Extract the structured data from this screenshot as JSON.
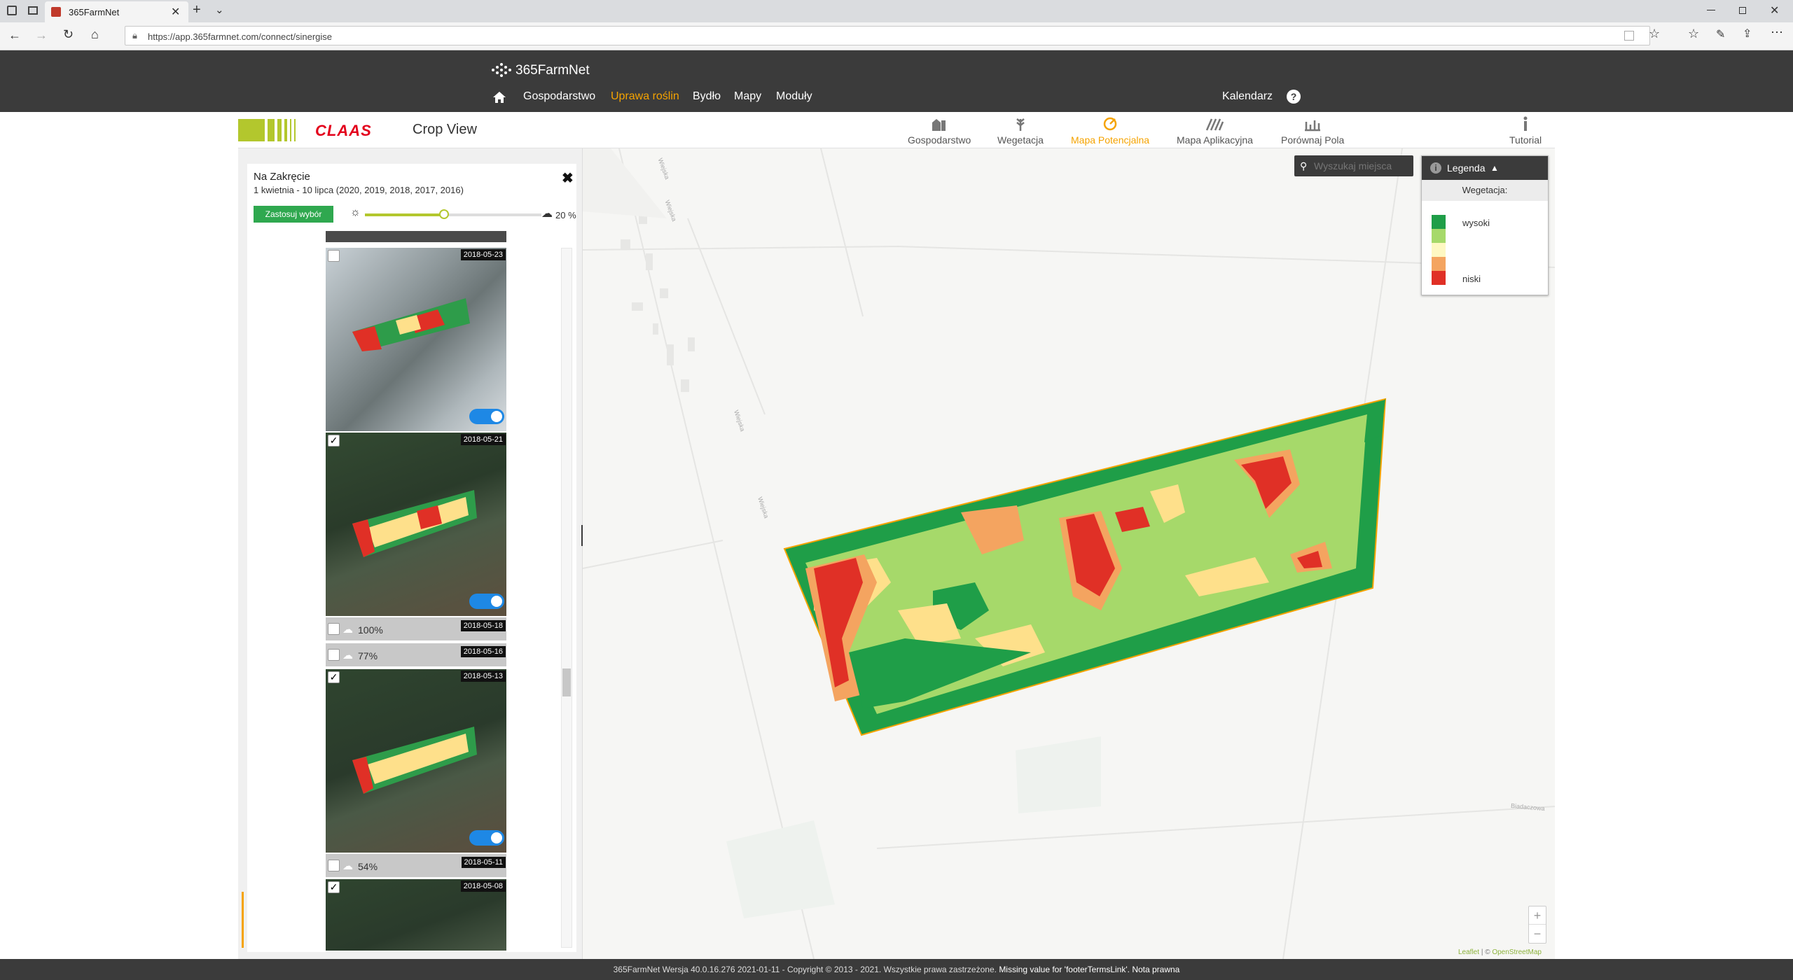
{
  "browser": {
    "tab_title": "365FarmNet",
    "url": "https://app.365farmnet.com/connect/sinergise"
  },
  "app": {
    "brand": "365FarmNet",
    "nav": [
      "Gospodarstwo",
      "Uprawa roślin",
      "Bydło",
      "Mapy",
      "Moduły"
    ],
    "active_nav": "Uprawa roślin",
    "calendar": "Kalendarz",
    "help": "?"
  },
  "subheader": {
    "brand": "CLAAS",
    "title": "Crop View",
    "tools": [
      "Gospodarstwo",
      "Wegetacja",
      "Mapa Potencjalna",
      "Mapa Aplikacyjna",
      "Porównaj Pola",
      "Tutorial"
    ],
    "active_tool": "Mapa Potencjalna"
  },
  "panel": {
    "field_name": "Na Zakręcie",
    "date_range": "1 kwietnia - 10 lipca (2020, 2019, 2018, 2017, 2016)",
    "apply_button": "Zastosuj wybór",
    "cloud_pct": "20 %",
    "cloud_slider_fraction": 0.45,
    "images": [
      {
        "date": "2018-05-23",
        "checked": false,
        "toggle_on": true
      },
      {
        "date": "2018-05-21",
        "checked": true,
        "toggle_on": true
      },
      {
        "date": "2018-05-18",
        "cloud": "100%"
      },
      {
        "date": "2018-05-16",
        "cloud": "77%"
      },
      {
        "date": "2018-05-13",
        "checked": true,
        "toggle_on": true
      },
      {
        "date": "2018-05-11",
        "cloud": "54%"
      },
      {
        "date": "2018-05-08",
        "checked": true
      }
    ]
  },
  "map": {
    "search_placeholder": "Wyszukaj miejsca",
    "legend_title": "Legenda",
    "legend_subtitle": "Wegetacja:",
    "legend_high": "wysoki",
    "legend_low": "niski",
    "legend_colors": [
      "#1f9e48",
      "#a6d96a",
      "#fee08b",
      "#f4a460",
      "#e03026"
    ],
    "road_labels": [
      "Wiejska",
      "Wiejska",
      "Wiejska",
      "Wiejska",
      "Biadaczowa"
    ],
    "attribution_leaflet": "Leaflet",
    "attribution_osm": "OpenStreetMap",
    "zoom_in": "+",
    "zoom_out": "−"
  },
  "footer": {
    "text": "365FarmNet Wersja 40.0.16.276 2021-01-11 - Copyright © 2013 - 2021. Wszystkie prawa zastrzeżone.",
    "missing": "Missing value for 'footerTermsLink'.",
    "legal": "Nota prawna"
  }
}
